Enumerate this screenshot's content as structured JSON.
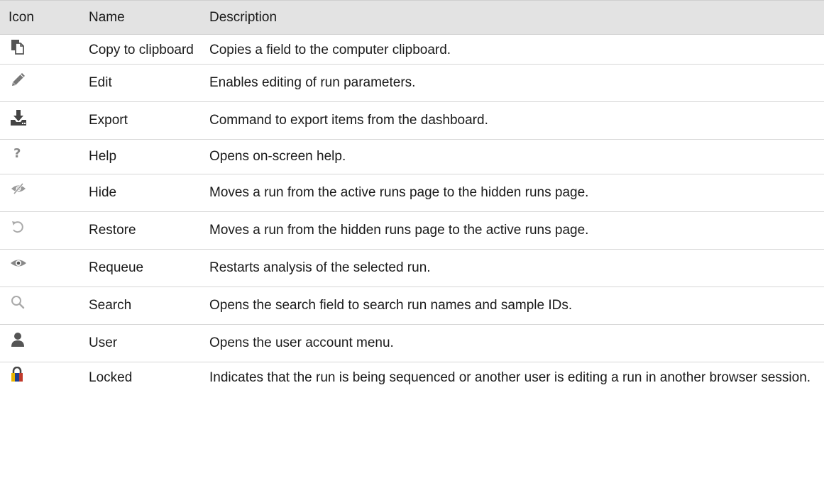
{
  "table": {
    "headers": {
      "icon": "Icon",
      "name": "Name",
      "description": "Description"
    },
    "rows": [
      {
        "icon": "copy-to-clipboard-icon",
        "name": "Copy to clipboard",
        "description": "Copies a field to the computer clipboard."
      },
      {
        "icon": "edit-pencil-icon",
        "name": "Edit",
        "description": "Enables editing of run parameters."
      },
      {
        "icon": "export-download-icon",
        "name": "Export",
        "description": "Command to export items from the dashboard."
      },
      {
        "icon": "help-question-icon",
        "name": "Help",
        "description": "Opens on-screen help."
      },
      {
        "icon": "hide-eye-slash-icon",
        "name": "Hide",
        "description": "Moves a run from the active runs page to the hidden runs page."
      },
      {
        "icon": "restore-arrow-icon",
        "name": "Restore",
        "description": "Moves a run from the hidden runs page to the active runs page."
      },
      {
        "icon": "requeue-eye-icon",
        "name": "Requeue",
        "description": "Restarts analysis of the selected run."
      },
      {
        "icon": "search-magnifier-icon",
        "name": "Search",
        "description": "Opens the search field to search run names and sample IDs."
      },
      {
        "icon": "user-icon",
        "name": "User",
        "description": "Opens the user account menu."
      },
      {
        "icon": "locked-padlock-icon",
        "name": "Locked",
        "description": "Indicates that the run is being sequenced or another user is editing a run in another browser session."
      }
    ]
  },
  "colors": {
    "header_background": "#e3e3e3",
    "row_divider": "#d6d6d6",
    "icon_dark": "#555555",
    "icon_light": "#aaaaaa",
    "lock_accent": "#1c3f8f"
  }
}
